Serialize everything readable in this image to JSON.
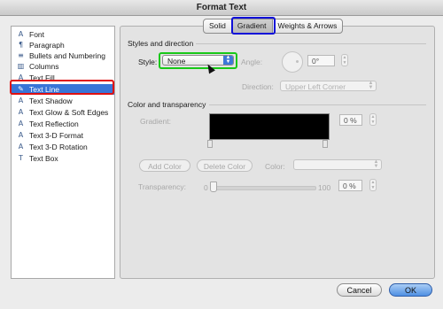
{
  "window": {
    "title": "Format Text"
  },
  "sidebar": {
    "items": [
      {
        "label": "Font",
        "icon": "font-icon",
        "glyph": "A"
      },
      {
        "label": "Paragraph",
        "icon": "paragraph-icon",
        "glyph": "¶"
      },
      {
        "label": "Bullets and Numbering",
        "icon": "bullets-icon",
        "glyph": "≡"
      },
      {
        "label": "Columns",
        "icon": "columns-icon",
        "glyph": "▥"
      },
      {
        "label": "Text Fill",
        "icon": "text-fill-icon",
        "glyph": "A"
      },
      {
        "label": "Text Line",
        "icon": "text-line-icon",
        "glyph": "✎"
      },
      {
        "label": "Text Shadow",
        "icon": "text-shadow-icon",
        "glyph": "A"
      },
      {
        "label": "Text Glow & Soft Edges",
        "icon": "text-glow-icon",
        "glyph": "A"
      },
      {
        "label": "Text Reflection",
        "icon": "text-reflection-icon",
        "glyph": "A"
      },
      {
        "label": "Text 3-D Format",
        "icon": "text-3d-format-icon",
        "glyph": "A"
      },
      {
        "label": "Text 3-D Rotation",
        "icon": "text-3d-rotation-icon",
        "glyph": "A"
      },
      {
        "label": "Text Box",
        "icon": "text-box-icon",
        "glyph": "T"
      }
    ],
    "selected": "Text Line"
  },
  "tabs": {
    "items": [
      "Solid",
      "Gradient",
      "Weights & Arrows"
    ],
    "active": "Gradient"
  },
  "styles_section": {
    "title": "Styles and direction",
    "style_label": "Style:",
    "style_value": "None",
    "angle_label": "Angle:",
    "angle_value": "0°",
    "direction_label": "Direction:",
    "direction_value": "Upper Left Corner"
  },
  "color_section": {
    "title": "Color and transparency",
    "gradient_label": "Gradient:",
    "gradient_pct": "0 %",
    "add_color_button": "Add Color",
    "delete_color_button": "Delete Color",
    "color_label": "Color:",
    "transparency_label": "Transparency:",
    "slider_min": "0",
    "slider_max": "100",
    "transparency_value": "0 %"
  },
  "footer": {
    "cancel_button": "Cancel",
    "ok_button": "OK"
  },
  "colors": {
    "selection": "#3875d7",
    "highlight_red": "#e01010",
    "highlight_blue": "#1010d8",
    "highlight_green": "#18c818"
  }
}
